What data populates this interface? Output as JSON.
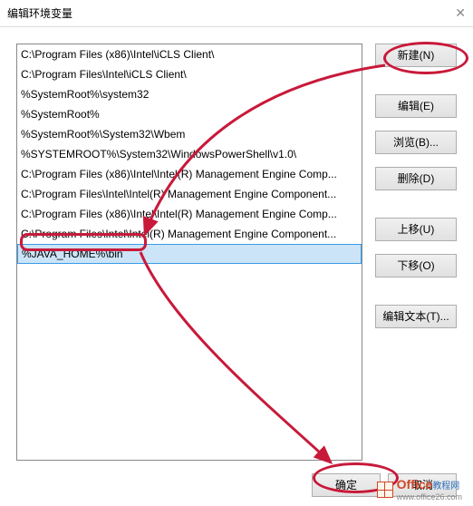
{
  "window": {
    "title": "编辑环境变量"
  },
  "list": {
    "items": [
      "C:\\Program Files (x86)\\Intel\\iCLS Client\\",
      "C:\\Program Files\\Intel\\iCLS Client\\",
      "%SystemRoot%\\system32",
      "%SystemRoot%",
      "%SystemRoot%\\System32\\Wbem",
      "%SYSTEMROOT%\\System32\\WindowsPowerShell\\v1.0\\",
      "C:\\Program Files (x86)\\Intel\\Intel(R) Management Engine Comp...",
      "C:\\Program Files\\Intel\\Intel(R) Management Engine Component...",
      "C:\\Program Files (x86)\\Intel\\Intel(R) Management Engine Comp...",
      "C:\\Program Files\\Intel\\Intel(R) Management Engine Component...",
      "%JAVA_HOME%\\bin"
    ],
    "selected_index": 10
  },
  "buttons": {
    "new_": "新建(N)",
    "edit": "编辑(E)",
    "browse": "浏览(B)...",
    "delete_": "删除(D)",
    "moveup": "上移(U)",
    "movedown": "下移(O)",
    "edittext": "编辑文本(T)...",
    "ok": "确定",
    "cancel": "取消"
  },
  "annotations": {
    "color": "#c8193a"
  },
  "watermark": {
    "brand_main": "Office",
    "brand_sub": "教程网",
    "url": "www.office26.com"
  }
}
